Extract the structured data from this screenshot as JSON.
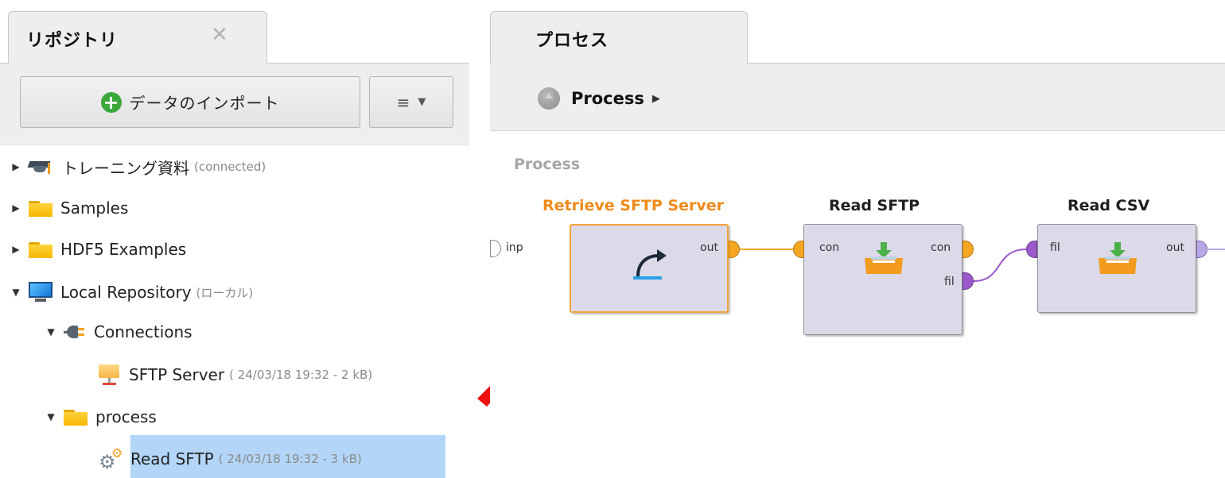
{
  "repository": {
    "tab_label": "リポジトリ",
    "close_glyph": "✕",
    "import_button_label": "データのインポート",
    "menu_glyph": "≡",
    "menu_caret": "▼",
    "tree": [
      {
        "label": "トレーニング資料",
        "meta": "(connected)",
        "icon": "graduation-cap-icon",
        "expanded": false
      },
      {
        "label": "Samples",
        "meta": "",
        "icon": "folder-icon",
        "expanded": false
      },
      {
        "label": "HDF5 Examples",
        "meta": "",
        "icon": "folder-icon",
        "expanded": false
      },
      {
        "label": "Local Repository",
        "meta": "(ローカル)",
        "icon": "monitor-icon",
        "expanded": true
      },
      {
        "label": "Connections",
        "meta": "",
        "icon": "plug-icon",
        "expanded": true
      },
      {
        "label": "SFTP Server",
        "meta": "( 24/03/18 19:32 - 2 kB)",
        "icon": "server-connection-icon"
      },
      {
        "label": "process",
        "meta": "",
        "icon": "folder-icon",
        "expanded": true
      },
      {
        "label": "Read SFTP",
        "meta": "( 24/03/18 19:32 - 3 kB)",
        "icon": "process-gear-icon",
        "selected": true
      }
    ]
  },
  "process": {
    "tab_label": "プロセス",
    "breadcrumb_label": "Process",
    "breadcrumb_caret": "▶",
    "canvas_title": "Process",
    "input_port_label": "inp",
    "operators": [
      {
        "name": "Retrieve SFTP Server",
        "active": true,
        "in_ports": [],
        "out_ports": [
          "out"
        ]
      },
      {
        "name": "Read SFTP",
        "active": false,
        "in_ports": [
          "con"
        ],
        "out_ports": [
          "con",
          "fil"
        ]
      },
      {
        "name": "Read CSV",
        "active": false,
        "in_ports": [
          "fil"
        ],
        "out_ports": [
          "out"
        ]
      }
    ]
  },
  "colors": {
    "active_operator": "#f08a1a",
    "selection": "#b3d6f8",
    "connection_wire": "#f5a623",
    "file_wire": "#9b59c9",
    "annotation_arrow": "#ee1111"
  }
}
